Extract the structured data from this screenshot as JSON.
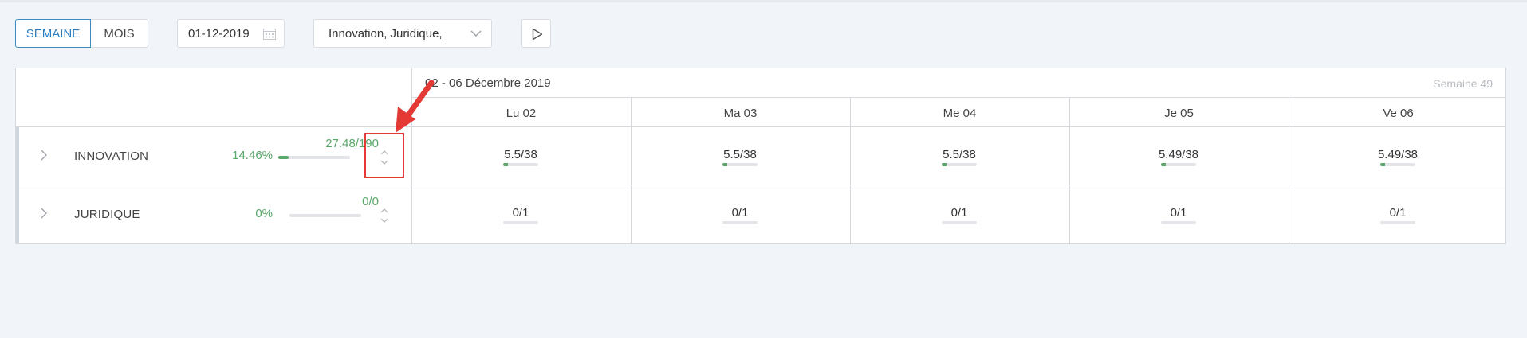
{
  "toolbar": {
    "week_label": "SEMAINE",
    "month_label": "MOIS",
    "date_value": "01-12-2019",
    "departments_value": "Innovation, Juridique,"
  },
  "grid": {
    "period": "02 - 06 Décembre 2019",
    "week": "Semaine 49",
    "days": [
      "Lu 02",
      "Ma 03",
      "Me 04",
      "Je 05",
      "Ve 06"
    ]
  },
  "rows": [
    {
      "name": "INNOVATION",
      "percent": "14.46%",
      "progress": 0.1446,
      "ratio": "27.48/190",
      "cells": [
        {
          "value": "5.5/38",
          "progress": 0.145
        },
        {
          "value": "5.5/38",
          "progress": 0.145
        },
        {
          "value": "5.5/38",
          "progress": 0.145
        },
        {
          "value": "5.49/38",
          "progress": 0.144
        },
        {
          "value": "5.49/38",
          "progress": 0.144
        }
      ]
    },
    {
      "name": "JURIDIQUE",
      "percent": "0%",
      "progress": 0,
      "ratio": "0/0",
      "cells": [
        {
          "value": "0/1",
          "progress": 0
        },
        {
          "value": "0/1",
          "progress": 0
        },
        {
          "value": "0/1",
          "progress": 0
        },
        {
          "value": "0/1",
          "progress": 0
        },
        {
          "value": "0/1",
          "progress": 0
        }
      ]
    }
  ],
  "colors": {
    "accent": "#2d7fbf",
    "progress": "#5aa76a",
    "annotation": "#e53935"
  },
  "icons": [
    "calendar-icon",
    "chevron-down-icon",
    "play-icon",
    "chevron-right-icon",
    "sort-toggle-icon",
    "annotation-arrow"
  ]
}
